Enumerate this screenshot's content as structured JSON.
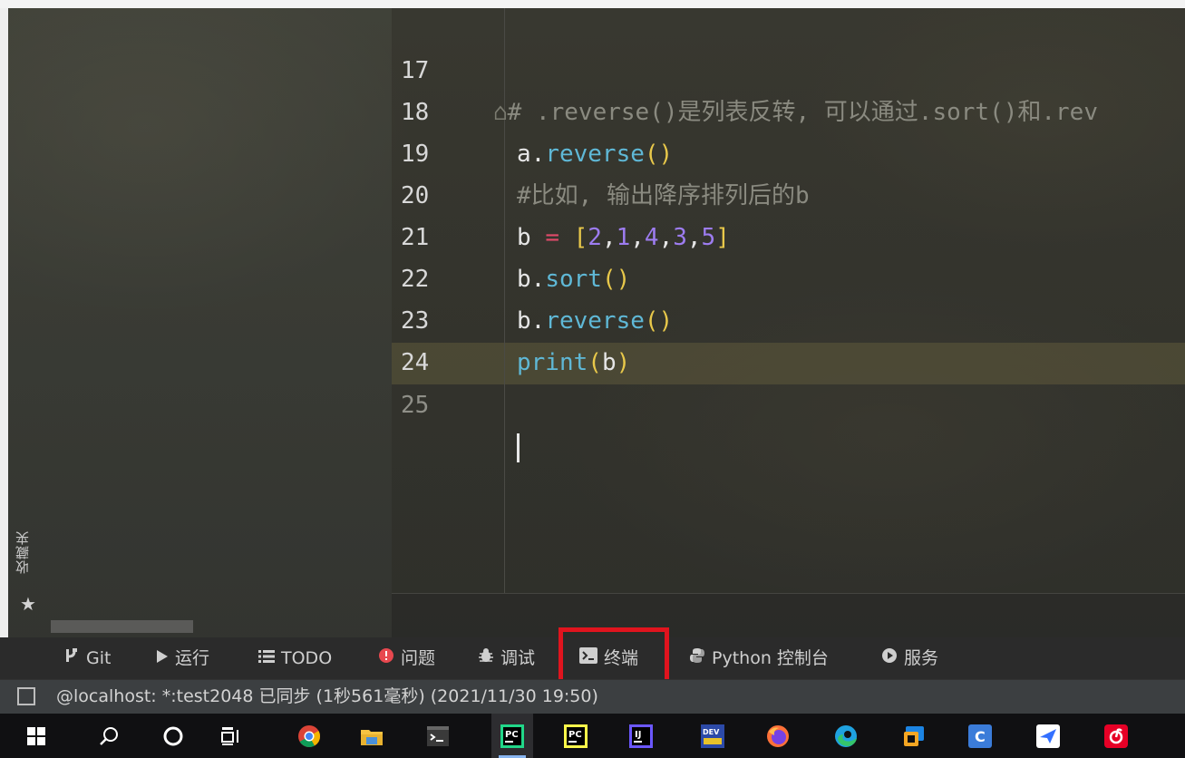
{
  "favorites_tab_label": "收藏夹",
  "editor": {
    "lines": [
      {
        "n": "17",
        "comment": "# .reverse()是列表反转, 可以通过.sort()和.rev"
      },
      {
        "n": "18",
        "obj": "a",
        "method": "reverse",
        "parens": "()"
      },
      {
        "n": "19",
        "comment": "#比如, 输出降序排列后的b"
      },
      {
        "n": "20",
        "var": "b",
        "op": "=",
        "open": "[",
        "nums": [
          "2",
          "1",
          "4",
          "3",
          "5"
        ],
        "close": "]"
      },
      {
        "n": "21",
        "obj": "b",
        "method": "sort",
        "parens": "()"
      },
      {
        "n": "22",
        "obj": "b",
        "method": "reverse",
        "parens": "()"
      },
      {
        "n": "23",
        "func": "print",
        "arg": "b"
      },
      {
        "n": "24"
      },
      {
        "n": "25"
      }
    ]
  },
  "tool_windows": [
    {
      "label": "Git",
      "icon": "git-branch-icon"
    },
    {
      "label": "运行",
      "icon": "run-play-icon"
    },
    {
      "label": "TODO",
      "icon": "todo-list-icon"
    },
    {
      "label": "问题",
      "icon": "problems-error-icon"
    },
    {
      "label": "调试",
      "icon": "debug-bug-icon"
    },
    {
      "label": "终端",
      "icon": "terminal-icon",
      "highlighted": true
    },
    {
      "label": "Python 控制台",
      "icon": "python-icon"
    },
    {
      "label": "服务",
      "icon": "services-icon"
    }
  ],
  "highlight_color": "#e0141e",
  "status_bar": {
    "text": "@localhost: *:test2048 已同步 (1秒561毫秒) (2021/11/30 19:50)"
  },
  "taskbar": {
    "items": [
      {
        "name": "windows-start-icon"
      },
      {
        "name": "search-icon"
      },
      {
        "name": "cortana-circle-icon"
      },
      {
        "name": "task-view-icon"
      },
      {
        "name": "chrome-icon"
      },
      {
        "name": "file-explorer-icon"
      },
      {
        "name": "terminal-app-icon"
      },
      {
        "name": "pycharm-icon",
        "label": "PC"
      },
      {
        "name": "pycharm-icon-2",
        "label": "PC"
      },
      {
        "name": "intellij-icon",
        "label": "IJ"
      },
      {
        "name": "devcpp-icon",
        "label": "DEV"
      },
      {
        "name": "firefox-icon"
      },
      {
        "name": "edge-icon"
      },
      {
        "name": "app-blue-icon"
      },
      {
        "name": "app-c-icon",
        "label": "C"
      },
      {
        "name": "feishu-icon"
      },
      {
        "name": "netease-music-icon"
      }
    ]
  }
}
